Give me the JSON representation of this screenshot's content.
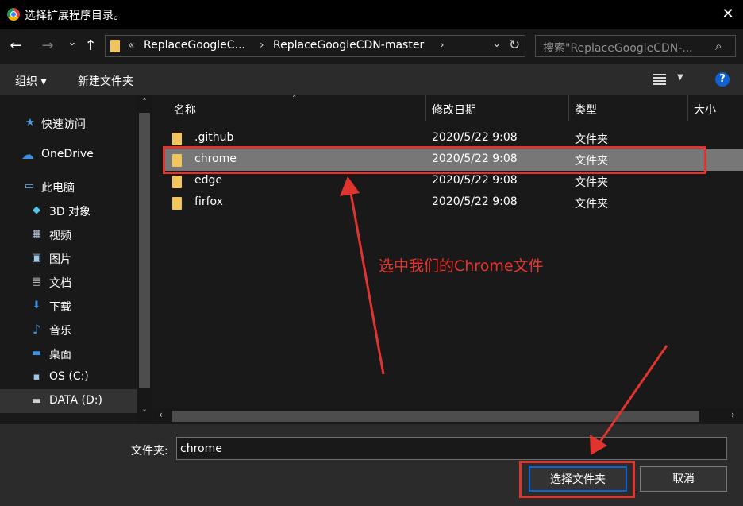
{
  "window": {
    "title": "选择扩展程序目录。",
    "close_glyph": "✕"
  },
  "nav": {
    "back_glyph": "←",
    "forward_glyph": "→",
    "history_glyph": "⌄",
    "up_glyph": "↑",
    "breadcrumb_overflow": "«",
    "breadcrumbs": [
      "ReplaceGoogleC...",
      "ReplaceGoogleCDN-master"
    ],
    "crumb_separator": "›",
    "dropdown_glyph": "⌄",
    "refresh_glyph": "↻",
    "search_placeholder": "搜索\"ReplaceGoogleCDN-...",
    "search_glyph": "⌕"
  },
  "toolbar": {
    "organize_label": "组织 ▾",
    "new_folder_label": "新建文件夹",
    "help_label": "?"
  },
  "sidebar": {
    "items": [
      {
        "label": "快速访问",
        "icon": "star-icon",
        "glyph": "★",
        "color": "#4a9fe8"
      },
      {
        "label": "OneDrive",
        "icon": "cloud-icon",
        "glyph": "☁",
        "color": "#3c8fe0"
      },
      {
        "label": "此电脑",
        "icon": "computer-icon",
        "glyph": "▭",
        "color": "#6fb4ea"
      },
      {
        "label": "3D 对象",
        "icon": "cube-icon",
        "glyph": "◆",
        "color": "#4fc3e8"
      },
      {
        "label": "视频",
        "icon": "film-icon",
        "glyph": "▦",
        "color": "#b9c7d6"
      },
      {
        "label": "图片",
        "icon": "picture-icon",
        "glyph": "▣",
        "color": "#9ec8e8"
      },
      {
        "label": "文档",
        "icon": "document-icon",
        "glyph": "▤",
        "color": "#d8dde3"
      },
      {
        "label": "下载",
        "icon": "download-icon",
        "glyph": "⬇",
        "color": "#3c8fe0"
      },
      {
        "label": "音乐",
        "icon": "music-icon",
        "glyph": "♪",
        "color": "#3c8fe0"
      },
      {
        "label": "桌面",
        "icon": "desktop-icon",
        "glyph": "▬",
        "color": "#3c8fe0"
      },
      {
        "label": "OS (C:)",
        "icon": "windows-drive-icon",
        "glyph": "▪",
        "color": "#9ec8e8"
      },
      {
        "label": "DATA (D:)",
        "icon": "drive-icon",
        "glyph": "▬",
        "color": "#cfcfcf"
      }
    ],
    "scroll_up_glyph": "˄",
    "scroll_down_glyph": "˅"
  },
  "columns": {
    "name": "名称",
    "modified": "修改日期",
    "type": "类型",
    "size": "大小",
    "sort_glyph": "˄"
  },
  "files": [
    {
      "name": ".github",
      "modified": "2020/5/22 9:08",
      "type": "文件夹"
    },
    {
      "name": "chrome",
      "modified": "2020/5/22 9:08",
      "type": "文件夹"
    },
    {
      "name": "edge",
      "modified": "2020/5/22 9:08",
      "type": "文件夹"
    },
    {
      "name": "firfox",
      "modified": "2020/5/22 9:08",
      "type": "文件夹"
    }
  ],
  "hscroll": {
    "left_glyph": "‹",
    "right_glyph": "›"
  },
  "footer": {
    "folder_label": "文件夹:",
    "folder_value": "chrome",
    "select_button": "选择文件夹",
    "cancel_button": "取消"
  },
  "annotation": {
    "text": "选中我们的Chrome文件",
    "color": "#e0342f"
  }
}
